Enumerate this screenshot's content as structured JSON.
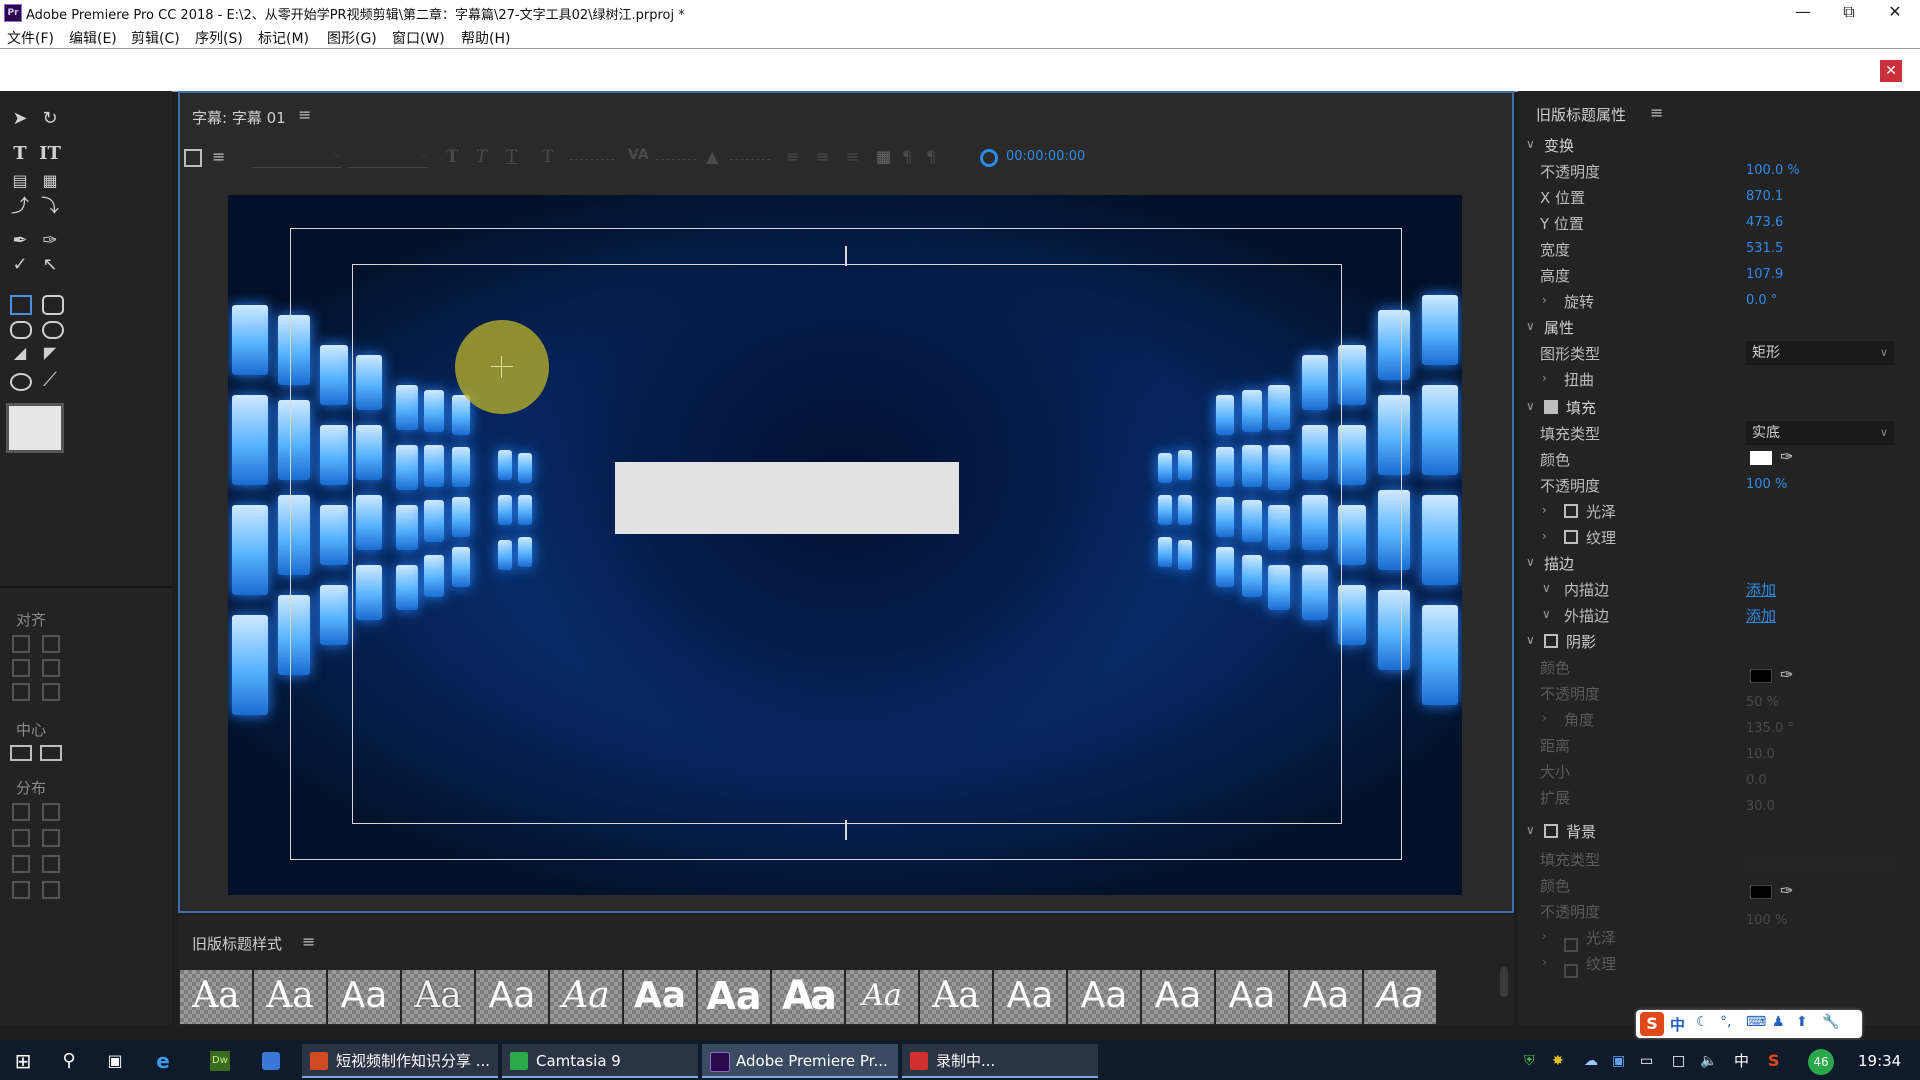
{
  "window": {
    "title": "Adobe Premiere Pro CC 2018 - E:\\2、从零开始学PR视频剪辑\\第二章：字幕篇\\27-文字工具02\\绿树江.prproj *"
  },
  "menu": [
    "文件(F)",
    "编辑(E)",
    "剪辑(C)",
    "序列(S)",
    "标记(M)",
    "图形(G)",
    "窗口(W)",
    "帮助(H)"
  ],
  "tools_panel": {
    "align_label": "对齐",
    "center_label": "中心",
    "distribute_label": "分布"
  },
  "title_panel": {
    "title": "字幕: 字幕 01",
    "timecode": "00:00:00:00"
  },
  "styles_panel": {
    "title": "旧版标题样式",
    "swatch_text": "Aa"
  },
  "props": {
    "title": "旧版标题属性",
    "transform": {
      "label": "变换",
      "opacity_label": "不透明度",
      "opacity": "100.0 %",
      "x_label": "X 位置",
      "x": "870.1",
      "y_label": "Y 位置",
      "y": "473.6",
      "width_label": "宽度",
      "width": "531.5",
      "height_label": "高度",
      "height": "107.9",
      "rotation_label": "旋转",
      "rotation": "0.0 °"
    },
    "properties": {
      "label": "属性",
      "shape_type_label": "图形类型",
      "shape_type": "矩形",
      "distort_label": "扭曲"
    },
    "fill": {
      "label": "填充",
      "checked": true,
      "type_label": "填充类型",
      "type": "实底",
      "color_label": "颜色",
      "color": "#ffffff",
      "opacity_label": "不透明度",
      "opacity": "100 %",
      "sheen_label": "光泽",
      "texture_label": "纹理"
    },
    "strokes": {
      "label": "描边",
      "inner_label": "内描边",
      "outer_label": "外描边",
      "add_label": "添加"
    },
    "shadow": {
      "label": "阴影",
      "checked": false,
      "color_label": "颜色",
      "color": "#000000",
      "opacity_label": "不透明度",
      "opacity": "50 %",
      "angle_label": "角度",
      "angle": "135.0 °",
      "distance_label": "距离",
      "distance": "10.0",
      "size_label": "大小",
      "size": "0.0",
      "spread_label": "扩展",
      "spread": "30.0"
    },
    "background": {
      "label": "背景",
      "checked": false,
      "type_label": "填充类型",
      "color_label": "颜色",
      "color": "#000000",
      "opacity_label": "不透明度",
      "opacity": "100 %",
      "sheen_label": "光泽",
      "texture_label": "纹理"
    }
  },
  "taskbar": {
    "apps": [
      "短视频制作知识分享 ...",
      "Camtasia 9",
      "Adobe Premiere Pr...",
      "录制中..."
    ],
    "tray_lang": "中",
    "tray_badge": "46",
    "clock": "19:34",
    "ime_text": "中"
  }
}
